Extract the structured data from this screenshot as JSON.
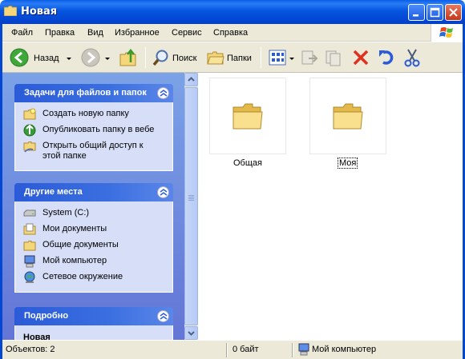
{
  "window": {
    "title": "Новая"
  },
  "menu": {
    "items": [
      "Файл",
      "Правка",
      "Вид",
      "Избранное",
      "Сервис",
      "Справка"
    ]
  },
  "toolbar": {
    "back_label": "Назад",
    "search_label": "Поиск",
    "folders_label": "Папки"
  },
  "taskpane": {
    "file_tasks": {
      "title": "Задачи для файлов и папок",
      "items": [
        {
          "label": "Создать новую папку",
          "icon": "new-folder-icon"
        },
        {
          "label": "Опубликовать папку в вебе",
          "icon": "web-publish-icon"
        },
        {
          "label": "Открыть общий доступ к этой папке",
          "icon": "share-folder-icon"
        }
      ]
    },
    "other_places": {
      "title": "Другие места",
      "items": [
        {
          "label": "System (C:)",
          "icon": "drive-icon"
        },
        {
          "label": "Мои документы",
          "icon": "my-documents-icon"
        },
        {
          "label": "Общие документы",
          "icon": "shared-documents-icon"
        },
        {
          "label": "Мой компьютер",
          "icon": "my-computer-icon"
        },
        {
          "label": "Сетевое окружение",
          "icon": "network-icon"
        }
      ]
    },
    "details": {
      "title": "Подробно",
      "first_line": "Новая"
    }
  },
  "content": {
    "items": [
      {
        "label": "Общая",
        "selected": false
      },
      {
        "label": "Моя",
        "selected": true
      }
    ]
  },
  "statusbar": {
    "objects": "Объектов: 2",
    "size": "0 байт",
    "location": "Мой компьютер"
  },
  "colors": {
    "titlebar": "#0347d3",
    "taskpane_bg": "#7ba2e7",
    "panel_header": "#2b5bd8",
    "panel_body": "#d6dff7",
    "folder_yellow": "#f3d77a"
  }
}
